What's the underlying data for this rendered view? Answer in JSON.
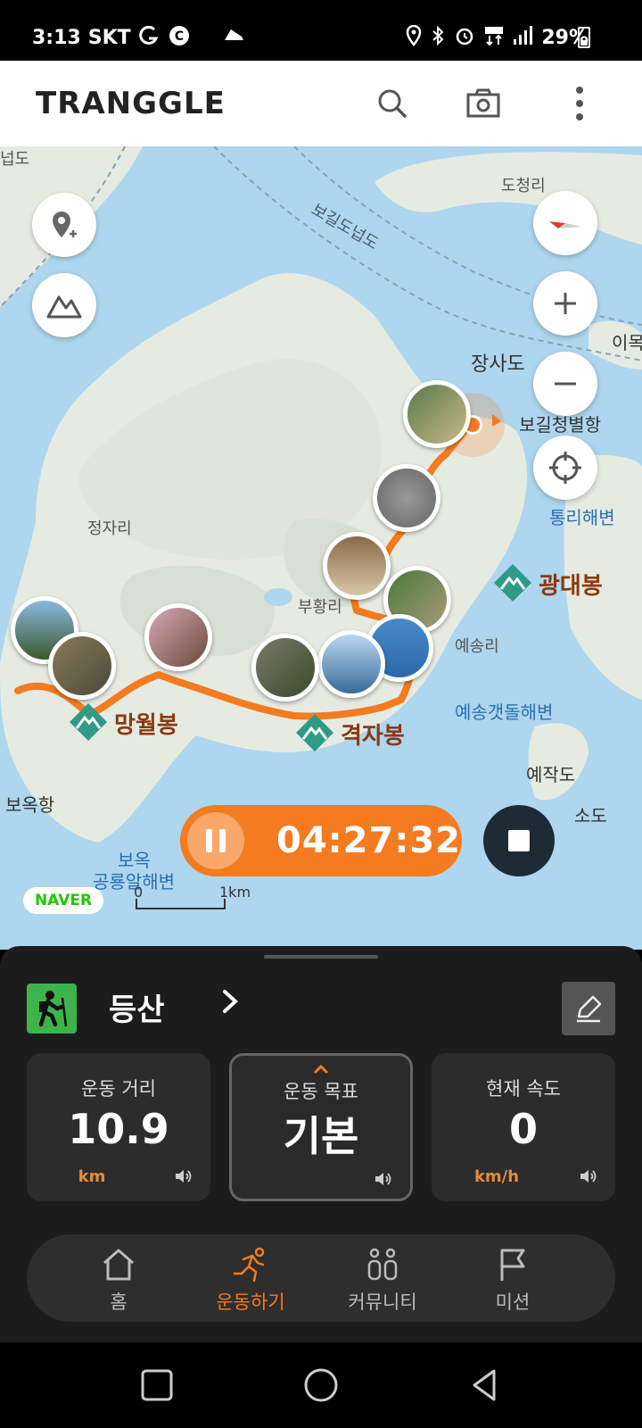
{
  "status": {
    "time": "3:13",
    "carrier": "SKT",
    "battery": "29%",
    "battery_level": 0.29
  },
  "header": {
    "logo": "TRANGGLE",
    "icons": [
      "search-icon",
      "camera-icon",
      "more-icon"
    ]
  },
  "map": {
    "places": {
      "p1": "넙도",
      "p2": "도청리",
      "p3": "보길도넙도",
      "p4": "장사도",
      "p5": "보길청별항",
      "p6": "이목",
      "p7": "정자리",
      "p8": "통리해변",
      "p9": "부황리",
      "p10": "예송리",
      "p11": "예송갯돌해변",
      "p12": "예작도",
      "p13": "소도",
      "p14": "보옥항",
      "p15": "보옥",
      "p16": "공룡알해변"
    },
    "peaks": {
      "mangwol": "망월봉",
      "gyeokja": "격자봉",
      "gwangdae": "광대봉"
    },
    "attribution": "NAVER",
    "scale_start": "0",
    "scale_end": "1km",
    "timer": "04:27:32"
  },
  "activity": {
    "title": "등산",
    "stats": [
      {
        "label": "운동 거리",
        "value": "10.9",
        "unit": "km"
      },
      {
        "label": "운동 목표",
        "value": "기본",
        "unit": ""
      },
      {
        "label": "현재 속도",
        "value": "0",
        "unit": "km/h"
      }
    ]
  },
  "nav": {
    "items": [
      {
        "label": "홈",
        "icon": "home-icon"
      },
      {
        "label": "운동하기",
        "icon": "running-icon"
      },
      {
        "label": "커뮤니티",
        "icon": "community-icon"
      },
      {
        "label": "미션",
        "icon": "flag-icon"
      }
    ],
    "active_index": 1
  },
  "colors": {
    "accent": "#f47b20",
    "sea": "#aed6ef",
    "land": "#e6ebe2",
    "sheet": "#1c1c1c",
    "peak_green": "#2f9a86"
  }
}
